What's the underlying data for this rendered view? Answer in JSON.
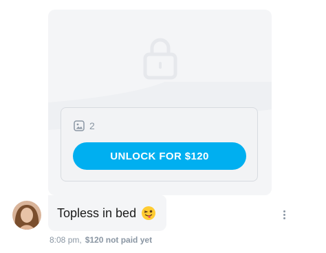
{
  "post": {
    "media_count": "2",
    "unlock_label": "UNLOCK FOR $120",
    "caption": "Topless in bed",
    "time": "8:08 pm,",
    "payment_status": "$120 not paid yet"
  },
  "icons": {
    "lock": "lock-icon",
    "image": "image-icon",
    "emoji": "winking-face-with-tongue-emoji",
    "more": "more-vertical-icon"
  },
  "colors": {
    "accent": "#00aff0",
    "muted_text": "#8a96a3",
    "bubble_bg": "#f4f5f7"
  }
}
